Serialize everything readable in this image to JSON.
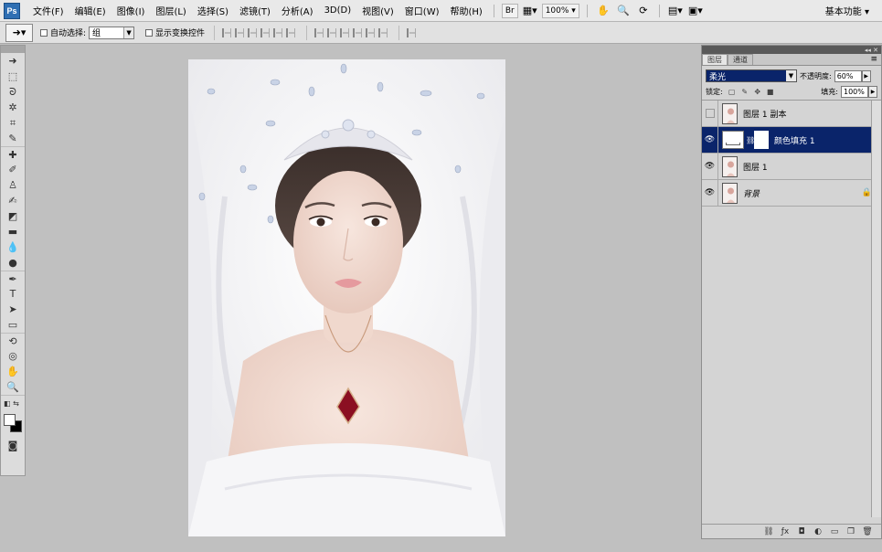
{
  "menubar": {
    "app_logo": "Ps",
    "items": [
      "文件(F)",
      "编辑(E)",
      "图像(I)",
      "图层(L)",
      "选择(S)",
      "滤镜(T)",
      "分析(A)",
      "3D(D)",
      "视图(V)",
      "窗口(W)",
      "帮助(H)"
    ],
    "bridge_label": "Br",
    "zoom": "100%",
    "workspace": "基本功能"
  },
  "options": {
    "auto_select_label": "自动选择:",
    "auto_select_value": "组",
    "show_transform_label": "显示变换控件"
  },
  "layers_panel": {
    "tabs": [
      "图层",
      "通道"
    ],
    "blend_mode": "柔光",
    "opacity_label": "不透明度:",
    "opacity_value": "60%",
    "lock_label": "锁定:",
    "fill_label": "填充:",
    "fill_value": "100%",
    "layers": [
      {
        "name": "图层 1 副本",
        "visible": false,
        "selected": false
      },
      {
        "name": "颜色填充 1",
        "visible": true,
        "selected": true
      },
      {
        "name": "图层 1",
        "visible": true,
        "selected": false
      },
      {
        "name": "背景",
        "visible": true,
        "selected": false,
        "locked": true
      }
    ]
  },
  "colors": {
    "accent": "#0a246a",
    "canvas_bg": "#c0c0c0",
    "foreground": "#ffffff",
    "background": "#000000"
  }
}
